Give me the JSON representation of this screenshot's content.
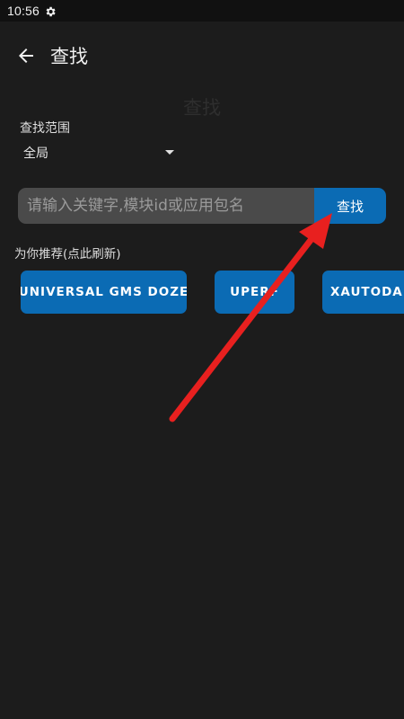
{
  "status_bar": {
    "time": "10:56",
    "settings_icon": "gear-icon"
  },
  "app_bar": {
    "back_icon": "arrow-left-icon",
    "title": "查找"
  },
  "ghost_heading": "查找",
  "scope": {
    "label": "查找范围",
    "selected": "全局"
  },
  "search": {
    "placeholder": "请输入关键字,模块id或应用包名",
    "value": "",
    "button_label": "查找"
  },
  "recommend": {
    "label": "为你推荐(点此刷新)",
    "chips": [
      "UNIVERSAL GMS DOZE",
      "UPERF",
      "XAUTODAIL"
    ]
  },
  "colors": {
    "background": "#1c1c1c",
    "accent": "#0b6bb4",
    "annotation_arrow": "#e8201f"
  }
}
